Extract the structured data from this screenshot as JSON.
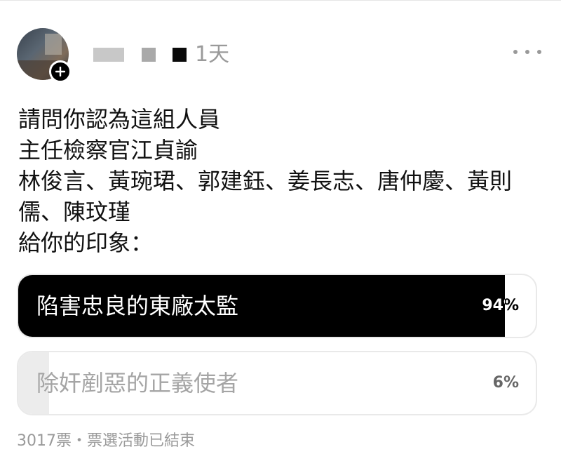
{
  "post": {
    "time": "1天",
    "lines": [
      "請問你認為這組人員",
      "主任檢察官江貞諭",
      "林俊言、黃琬珺、郭建鈺、姜長志、唐仲慶、黃則",
      "儒、陳玟瑾",
      "給你的印象："
    ]
  },
  "poll": {
    "options": [
      {
        "label": "陷害忠良的東廠太監",
        "percent_label": "94%",
        "percent": 94
      },
      {
        "label": "除奸剷惡的正義使者",
        "percent_label": "6%",
        "percent": 6
      }
    ],
    "footer": "3017票・票選活動已結束"
  },
  "icons": {
    "more": "more-horizontal-icon",
    "follow": "plus-icon"
  },
  "colors": {
    "winning_fill": "#000000",
    "losing_fill": "#ececec",
    "muted_text": "#9a9a9a"
  }
}
